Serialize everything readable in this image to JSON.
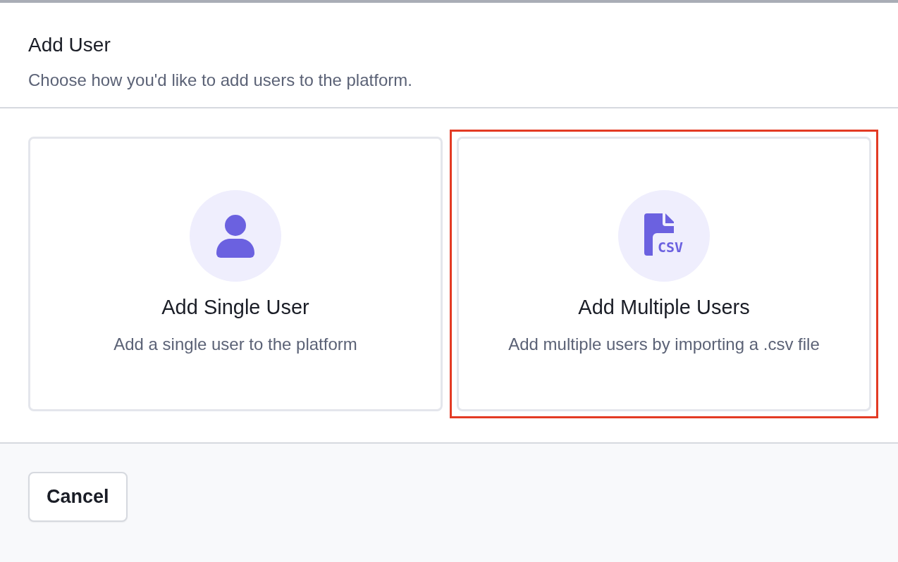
{
  "dialog": {
    "title": "Add User",
    "subtitle": "Choose how you'd like to add users to the platform."
  },
  "options": [
    {
      "kind": "single",
      "title": "Add Single User",
      "description": "Add a single user to the platform",
      "selected": false
    },
    {
      "kind": "csv",
      "title": "Add Multiple Users",
      "description": "Add multiple users by importing a .csv file",
      "icon_text": "CSV",
      "selected": true
    }
  ],
  "footer": {
    "buttons": [
      "Cancel"
    ]
  }
}
